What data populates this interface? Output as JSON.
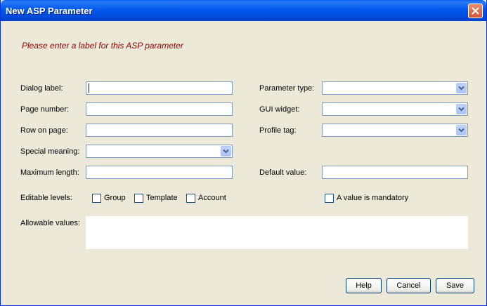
{
  "window": {
    "title": "New ASP Parameter"
  },
  "prompt": "Please enter a label for this ASP parameter",
  "fields": {
    "dialog_label": {
      "label": "Dialog label:",
      "value": ""
    },
    "page_number": {
      "label": "Page number:",
      "value": ""
    },
    "row_on_page": {
      "label": "Row on page:",
      "value": ""
    },
    "special_meaning": {
      "label": "Special meaning:",
      "value": ""
    },
    "maximum_length": {
      "label": "Maximum length:",
      "value": ""
    },
    "parameter_type": {
      "label": "Parameter type:",
      "value": ""
    },
    "gui_widget": {
      "label": "GUI widget:",
      "value": ""
    },
    "profile_tag": {
      "label": "Profile tag:",
      "value": ""
    },
    "default_value": {
      "label": "Default value:",
      "value": ""
    },
    "editable_levels": {
      "label": "Editable levels:",
      "options": [
        "Group",
        "Template",
        "Account"
      ]
    },
    "mandatory": {
      "label": "A value is mandatory"
    },
    "allowable_values": {
      "label": "Allowable values:",
      "value": ""
    }
  },
  "buttons": {
    "help": "Help",
    "cancel": "Cancel",
    "save": "Save"
  },
  "icons": {
    "close": "close-icon",
    "dropdown": "chevron-down-icon"
  },
  "colors": {
    "title_bar": "#0058EE",
    "prompt": "#8B0000",
    "background": "#ECE9D8"
  }
}
